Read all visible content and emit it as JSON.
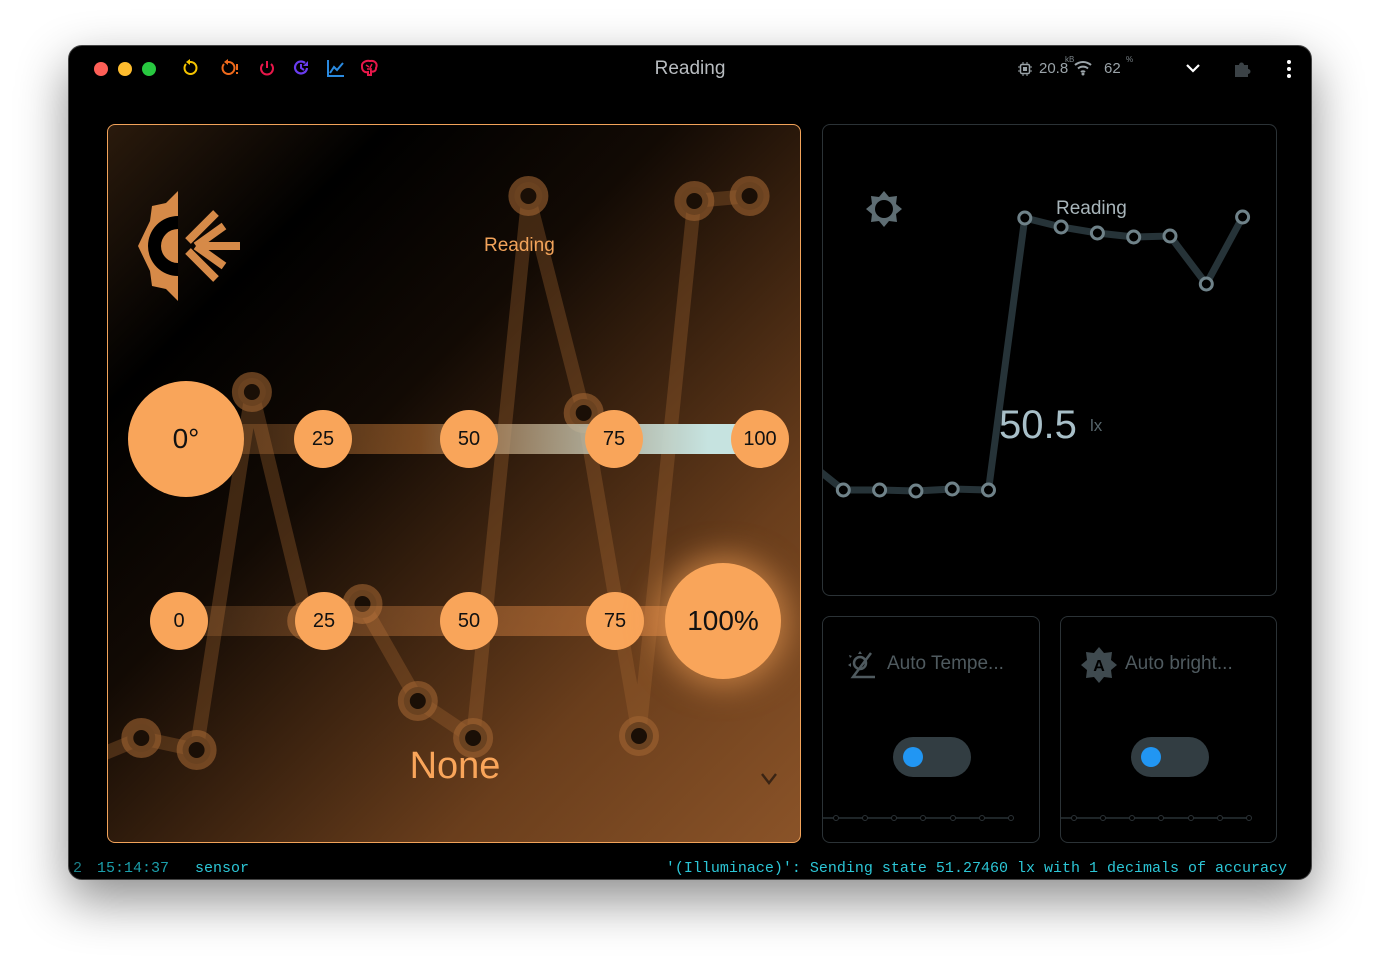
{
  "window": {
    "title": "Reading"
  },
  "toolbar": {
    "icons": [
      "restart-icon",
      "restart-warning-icon",
      "power-icon",
      "history-icon",
      "chart-icon",
      "brain-icon"
    ],
    "colors": [
      "#f5c400",
      "#f06a1c",
      "#e8174a",
      "#6a3cf0",
      "#2a8ae0",
      "#e8174a"
    ]
  },
  "status": {
    "memory": "20.8",
    "memory_unit": "kB",
    "wifi": "62",
    "wifi_unit": "%"
  },
  "main_card": {
    "label": "Reading",
    "value": "None",
    "temp_slider": {
      "value": "0°",
      "ticks": [
        "25",
        "50",
        "75",
        "100"
      ]
    },
    "brightness_slider": {
      "value": "100%",
      "ticks": [
        "0",
        "25",
        "50",
        "75"
      ],
      "level_percent": 100
    },
    "background_sparkline": [
      100,
      123,
      111,
      469,
      240,
      257,
      160,
      123,
      665,
      448,
      125,
      660,
      665
    ],
    "accent": "#f9a55a"
  },
  "sensor_card": {
    "label": "Reading",
    "value": "50.5",
    "unit": "lx",
    "sparkline": [
      45,
      16,
      16,
      15,
      17,
      16,
      288,
      279,
      273,
      269,
      270,
      222,
      289
    ]
  },
  "switches": [
    {
      "label": "Auto Tempe...",
      "on": false
    },
    {
      "label": "Auto bright...",
      "on": false
    }
  ],
  "log": {
    "index": "2",
    "time": "15:14:37",
    "source": "sensor",
    "message": "'(Illuminace)': Sending state 51.27460 lx with 1 decimals of accuracy"
  }
}
